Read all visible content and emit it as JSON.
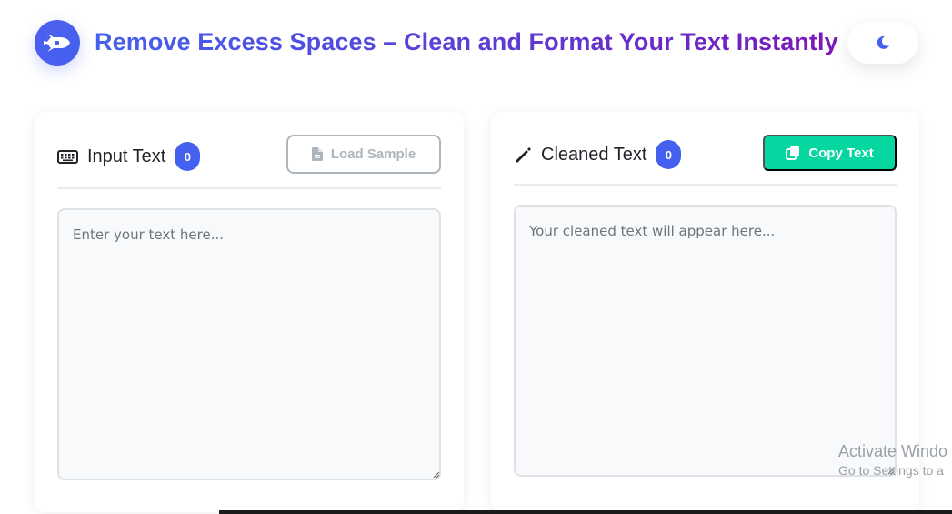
{
  "header": {
    "title": "Remove Excess Spaces – Clean and Format Your Text Instantly",
    "logo_icon": "space-shuttle-icon",
    "theme_toggle_icon": "moon-icon"
  },
  "input_panel": {
    "title": "Input Text",
    "icon": "keyboard-icon",
    "count": "0",
    "load_sample_label": "Load Sample",
    "load_sample_icon": "file-icon",
    "placeholder": "Enter your text here..."
  },
  "output_panel": {
    "title": "Cleaned Text",
    "icon": "magic-wand-icon",
    "count": "0",
    "copy_label": "Copy Text",
    "copy_icon": "copy-icon",
    "placeholder": "Your cleaned text will appear here..."
  },
  "watermark": {
    "line1": "Activate Windo",
    "line2": "Go to Settings to a"
  },
  "colors": {
    "primary": "#4361ee",
    "accent_purple": "#7a18b8",
    "success": "#06d6a0",
    "muted": "#adb5bd"
  }
}
